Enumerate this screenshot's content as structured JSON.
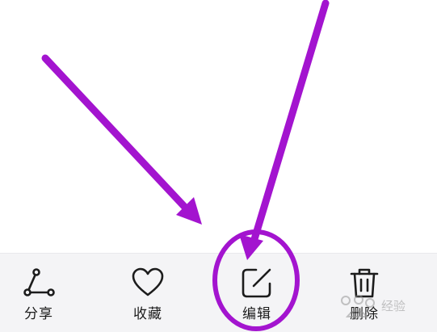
{
  "toolbar": {
    "share_label": "分享",
    "favorite_label": "收藏",
    "edit_label": "编辑",
    "delete_label": "删除"
  },
  "annotation": {
    "arrow_color": "#a314cf",
    "highlight_color": "#a314cf"
  },
  "watermark": {
    "text": "经验"
  }
}
